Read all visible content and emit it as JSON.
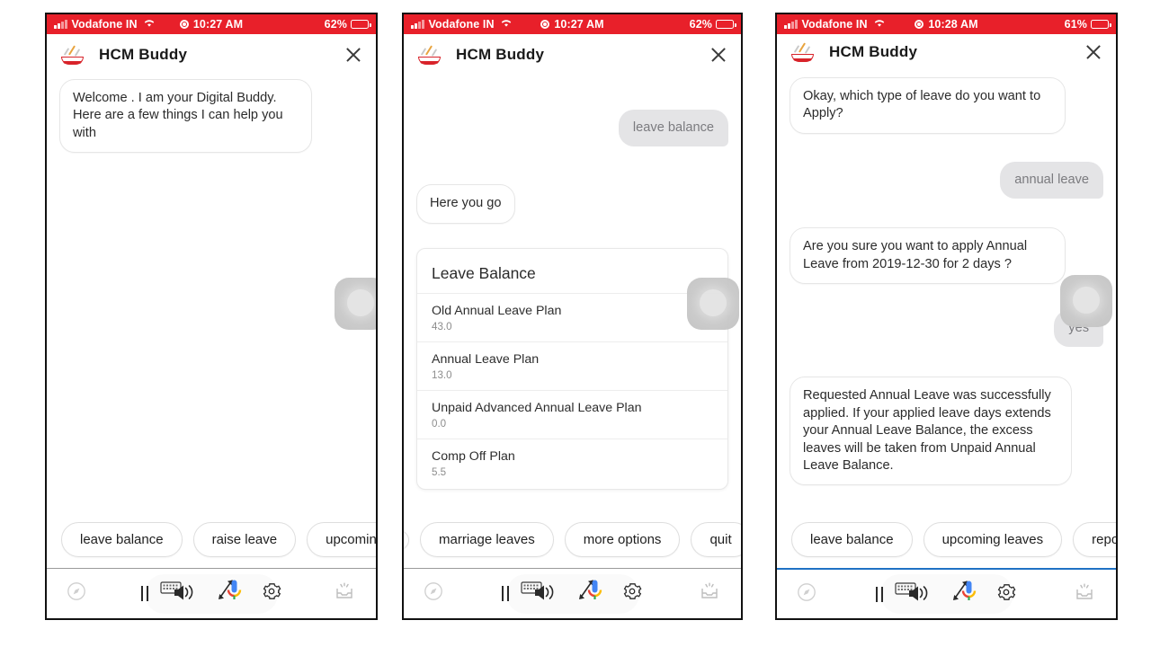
{
  "app": {
    "title": "HCM Buddy",
    "logo_icon": "soup-bowl-logo",
    "close_icon": "close-icon",
    "accent_red": "#e8202a",
    "accent_blue": "#1f72c4"
  },
  "panels": [
    {
      "id": "panel-1",
      "status": {
        "carrier": "Vodafone IN",
        "wifi_icon": "wifi-icon",
        "location_icon": "location-icon",
        "time": "10:27 AM",
        "battery_percent": "62%",
        "battery_icon": "battery-icon"
      },
      "messages": [
        {
          "from": "bot",
          "text": "Welcome . I am your Digital Buddy. Here are a few things I can help you with"
        }
      ],
      "chips": [
        "leave balance",
        "raise leave",
        "upcoming leaves"
      ],
      "toolbar": {
        "compass_icon": "compass-icon",
        "pause_icon": "pause-icon",
        "keyboard_speaker_icon": "keyboard-speaker-icon",
        "mic_expand_icon": "mic-expand-icon",
        "gear_icon": "gear-icon",
        "tray_icon": "inbox-tray-icon",
        "divider_blue": false
      }
    },
    {
      "id": "panel-2",
      "status": {
        "carrier": "Vodafone IN",
        "wifi_icon": "wifi-icon",
        "location_icon": "location-icon",
        "time": "10:27 AM",
        "battery_percent": "62%",
        "battery_icon": "battery-icon"
      },
      "messages": [
        {
          "from": "user",
          "text": "leave balance"
        },
        {
          "from": "bot",
          "text": "Here you go"
        }
      ],
      "card": {
        "title": "Leave Balance",
        "rows": [
          {
            "name": "Old Annual Leave Plan",
            "value": "43.0"
          },
          {
            "name": "Annual Leave Plan",
            "value": "13.0"
          },
          {
            "name": "Unpaid Advanced Annual Leave Plan",
            "value": "0.0"
          },
          {
            "name": "Comp Off Plan",
            "value": "5.5"
          }
        ]
      },
      "chips": [
        "marriage leaves",
        "more options",
        "quit"
      ],
      "toolbar": {
        "compass_icon": "compass-icon",
        "pause_icon": "pause-icon",
        "keyboard_speaker_icon": "keyboard-speaker-icon",
        "mic_expand_icon": "mic-expand-icon",
        "gear_icon": "gear-icon",
        "tray_icon": "inbox-tray-icon",
        "divider_blue": false
      }
    },
    {
      "id": "panel-3",
      "status": {
        "carrier": "Vodafone IN",
        "wifi_icon": "wifi-icon",
        "location_icon": "location-icon",
        "time": "10:28 AM",
        "battery_percent": "61%",
        "battery_icon": "battery-icon"
      },
      "messages": [
        {
          "from": "bot",
          "text": "Okay, which type of leave do you want to Apply?"
        },
        {
          "from": "user",
          "text": "annual leave"
        },
        {
          "from": "bot",
          "text": "Are you sure you want to apply Annual Leave from 2019-12-30 for 2 days ?"
        },
        {
          "from": "user",
          "text": "yes"
        },
        {
          "from": "bot",
          "text": "Requested Annual Leave was successfully applied. If your applied leave days extends your Annual Leave Balance, the excess leaves will be taken from Unpaid Annual Leave Balance."
        }
      ],
      "chips": [
        "leave balance",
        "upcoming leaves",
        "report"
      ],
      "toolbar": {
        "compass_icon": "compass-icon",
        "pause_icon": "pause-icon",
        "keyboard_speaker_icon": "keyboard-speaker-icon",
        "mic_expand_icon": "mic-expand-icon",
        "gear_icon": "gear-icon",
        "tray_icon": "inbox-tray-icon",
        "divider_blue": true
      }
    }
  ],
  "overlay": {
    "icon": "floating-action-square"
  }
}
